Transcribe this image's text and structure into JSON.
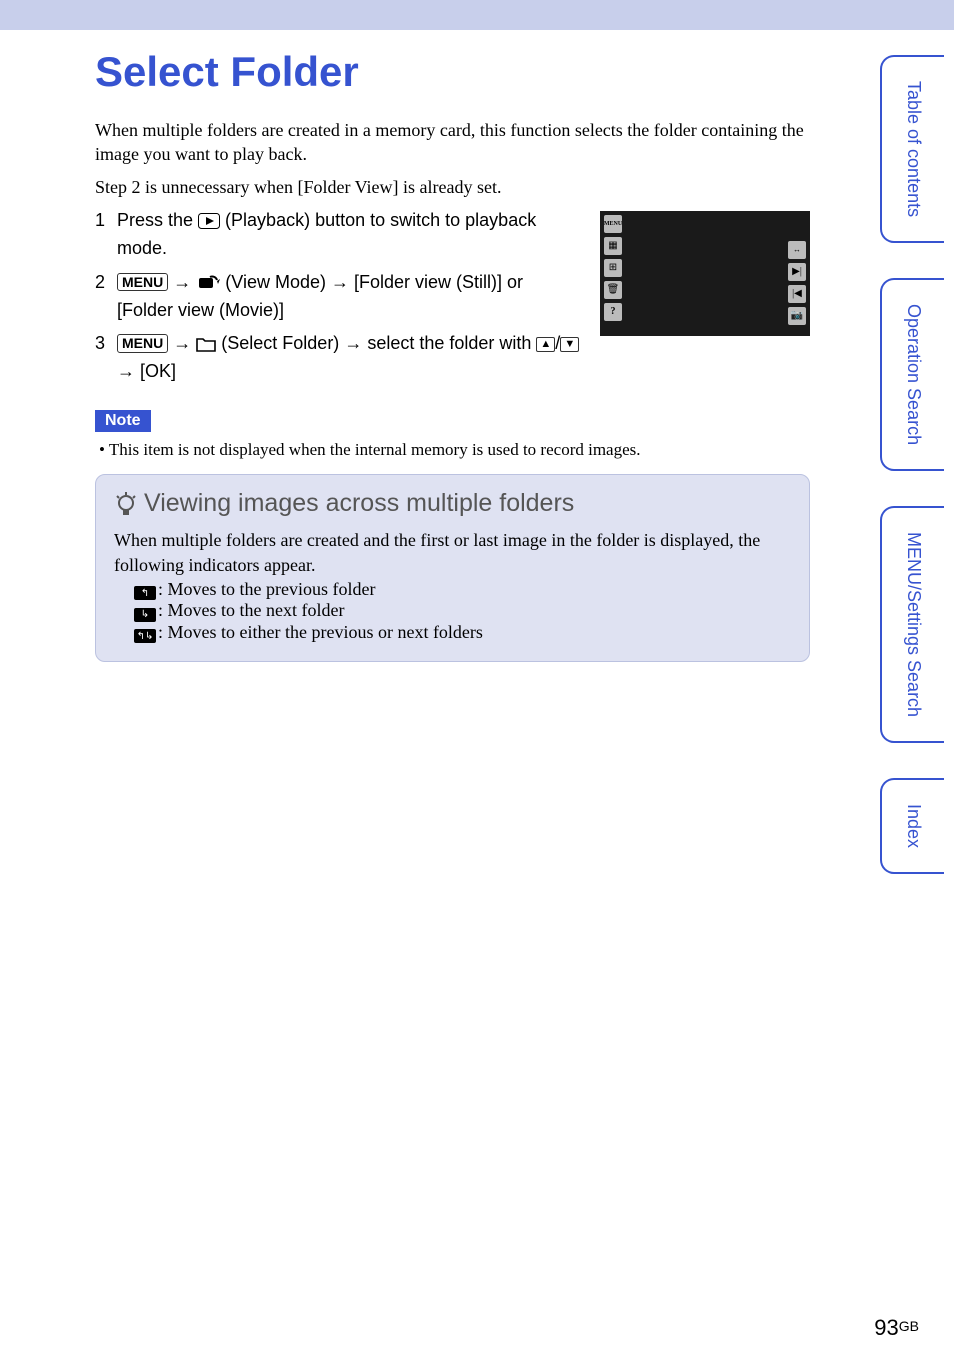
{
  "title": "Select Folder",
  "intro_p1": "When multiple folders are created in a memory card, this function selects the folder containing the image you want to play back.",
  "intro_p2": "Step 2 is unnecessary when [Folder View] is already set.",
  "steps": {
    "s1_num": "1",
    "s1_a": "Press the ",
    "s1_b": " (Playback) button to switch to playback mode.",
    "s2_num": "2",
    "s2_menu": "MENU",
    "s2_a": " (View Mode) ",
    "s2_b": " [Folder view (Still)] or [Folder view (Movie)]",
    "s3_num": "3",
    "s3_menu": "MENU",
    "s3_a": " (Select Folder) ",
    "s3_b": " select the folder with ",
    "s3_c": " [OK]"
  },
  "note_label": "Note",
  "note_bullet": "•  This item is not displayed when the internal memory is used to record images.",
  "tip_title": "Viewing images across multiple folders",
  "tip_intro": "When multiple folders are created and the first or last image in the folder is displayed, the following indicators appear.",
  "tip_li1": ": Moves to the previous folder",
  "tip_li2": ": Moves to the next folder",
  "tip_li3": ": Moves to either the previous or next folders",
  "tabs": {
    "t1": "Table of contents",
    "t2": "Operation Search",
    "t3": "MENU/Settings Search",
    "t4": "Index"
  },
  "page_num": "93",
  "page_suffix": "GB",
  "glyphs": {
    "arrow": "→",
    "up": "▲",
    "down": "▼",
    "slash": "/"
  }
}
